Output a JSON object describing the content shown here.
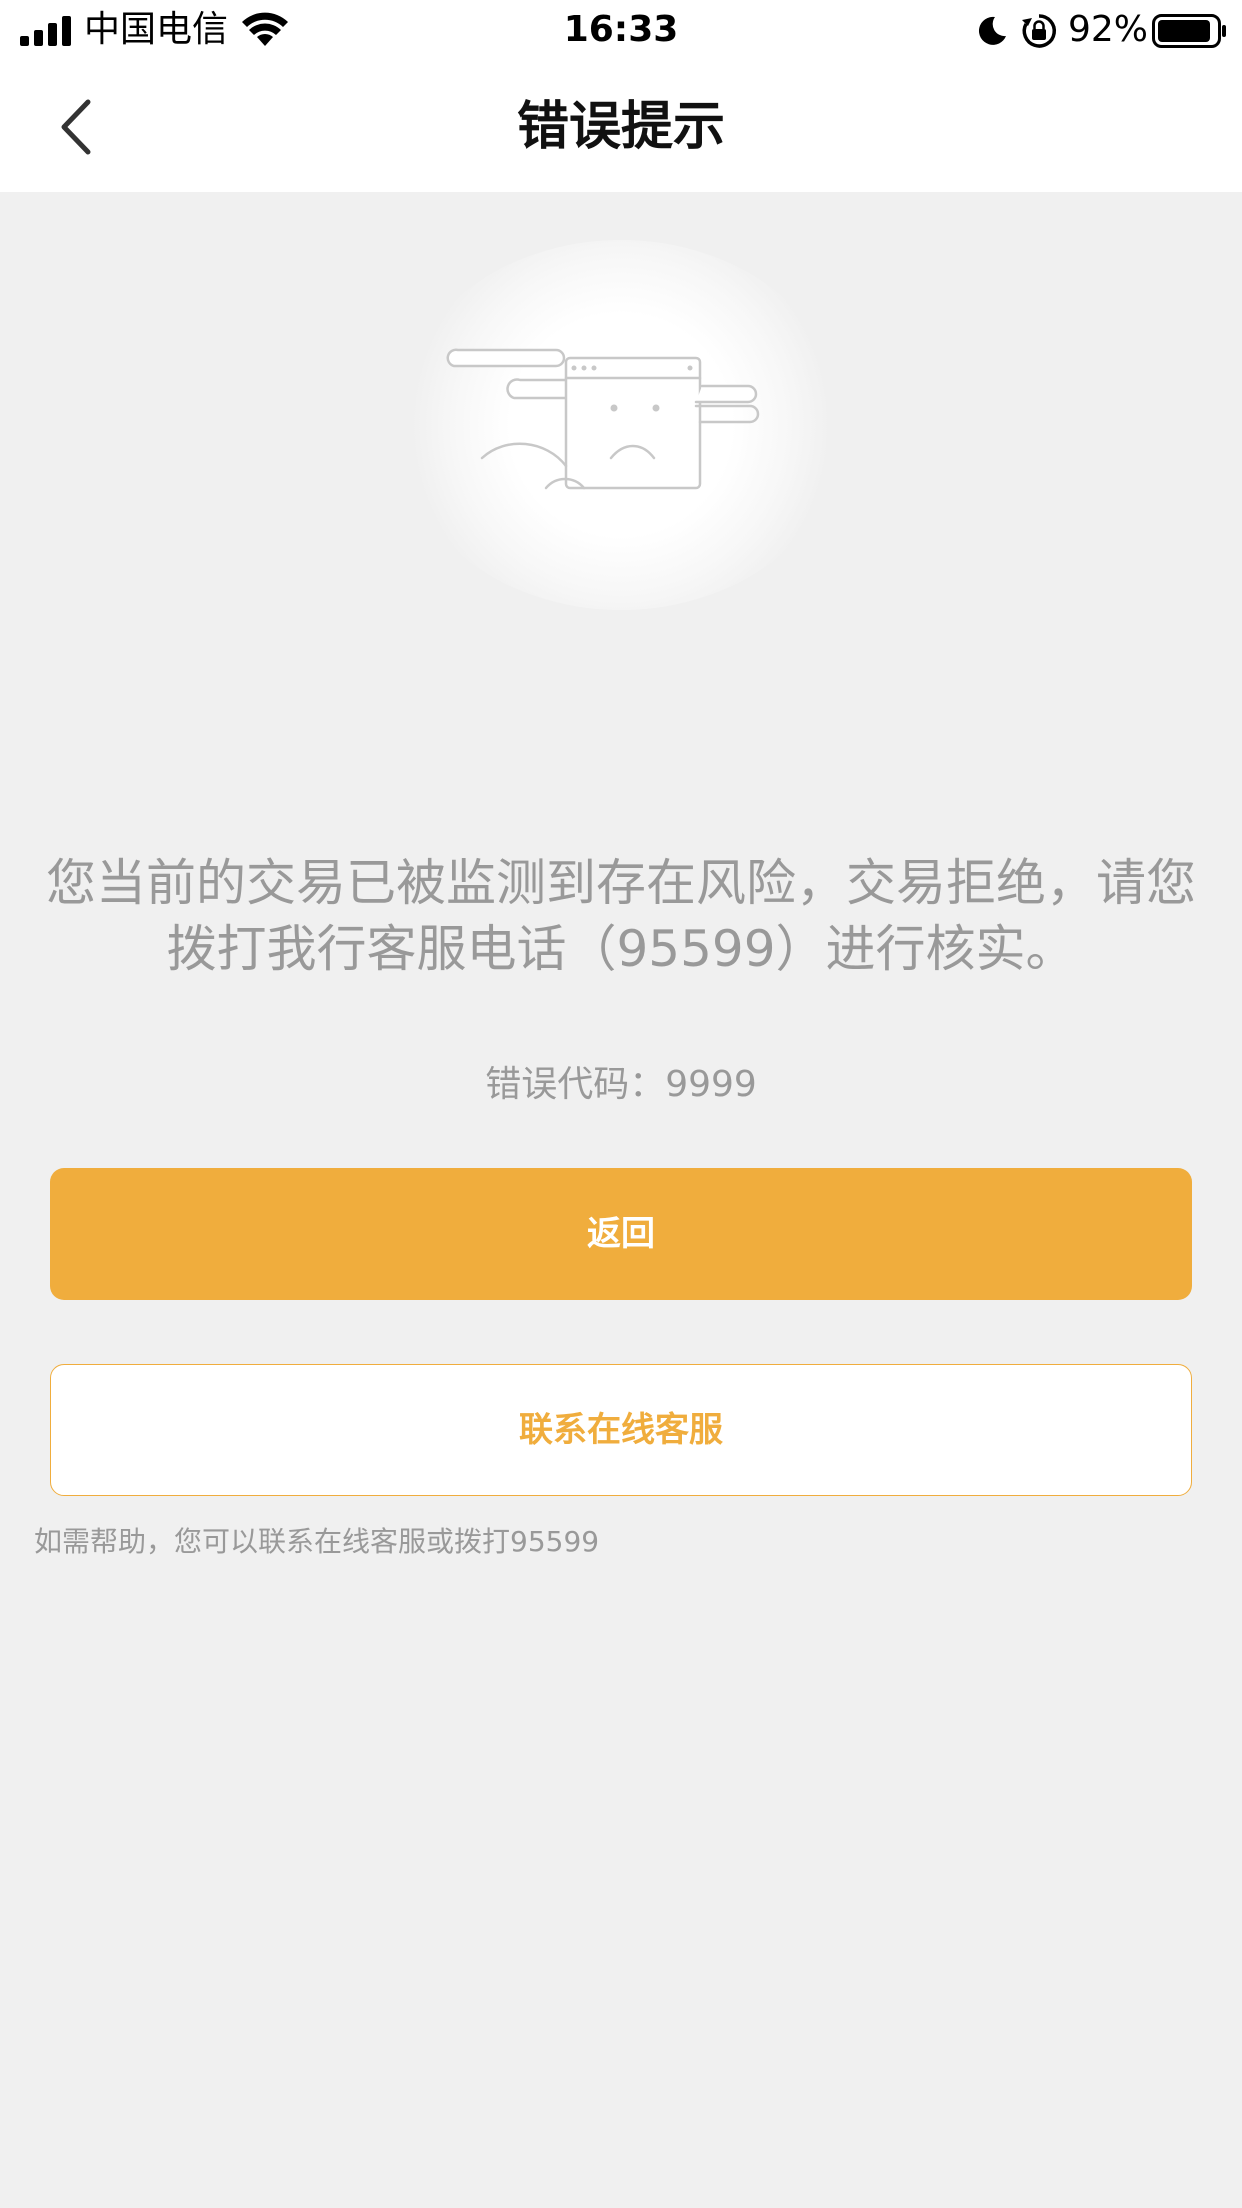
{
  "status_bar": {
    "carrier": "中国电信",
    "time": "16:33",
    "battery_percent": "92%",
    "battery_level": 0.92
  },
  "nav": {
    "title": "错误提示",
    "back_icon": "chevron-left-icon"
  },
  "illustration": {
    "icon": "sad-window-icon"
  },
  "content": {
    "message": "您当前的交易已被监测到存在风险，交易拒绝，请您拨打我行客服电话（95599）进行核实。",
    "error_code": "错误代码：9999"
  },
  "buttons": {
    "return_label": "返回",
    "service_label": "联系在线客服"
  },
  "help_text": "如需帮助，您可以联系在线客服或拨打95599",
  "colors": {
    "accent": "#f0ad3d",
    "background": "#f0f0f0",
    "muted_text": "#999999"
  }
}
